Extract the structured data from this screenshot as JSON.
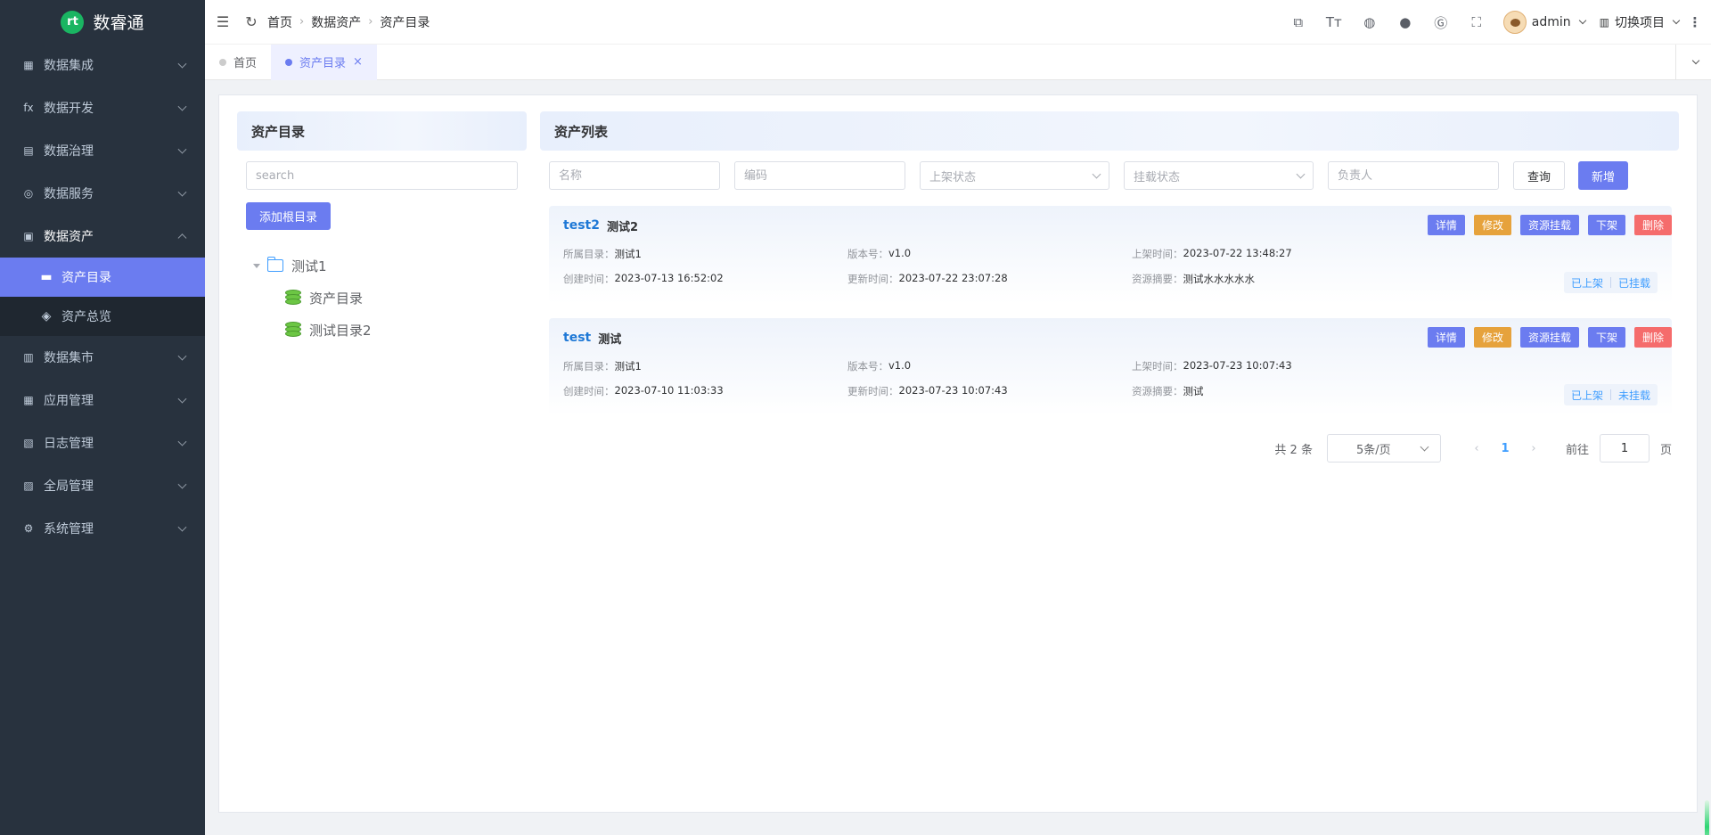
{
  "app": {
    "name": "数睿通"
  },
  "sidebar": {
    "items": [
      {
        "label": "数据集成",
        "icon": "chart-grid-icon",
        "glyph": "▦",
        "open": false
      },
      {
        "label": "数据开发",
        "icon": "function-icon",
        "glyph": "fx",
        "open": false
      },
      {
        "label": "数据治理",
        "icon": "table-icon",
        "glyph": "▤",
        "open": false
      },
      {
        "label": "数据服务",
        "icon": "service-icon",
        "glyph": "◎",
        "open": false
      },
      {
        "label": "数据资产",
        "icon": "terminal-icon",
        "glyph": "▣",
        "open": true
      },
      {
        "label": "数据集市",
        "icon": "market-icon",
        "glyph": "▥",
        "open": false
      },
      {
        "label": "应用管理",
        "icon": "app-icon",
        "glyph": "▦",
        "open": false
      },
      {
        "label": "日志管理",
        "icon": "log-icon",
        "glyph": "▧",
        "open": false
      },
      {
        "label": "全局管理",
        "icon": "global-icon",
        "glyph": "▨",
        "open": false
      },
      {
        "label": "系统管理",
        "icon": "settings-icon",
        "glyph": "⚙",
        "open": false
      }
    ],
    "subitems": [
      {
        "label": "资产目录",
        "icon": "catalog-icon",
        "glyph": "▬",
        "active": true
      },
      {
        "label": "资产总览",
        "icon": "overview-icon",
        "glyph": "◈",
        "active": false
      }
    ]
  },
  "navbar": {
    "breadcrumb": [
      "首页",
      "数据资产",
      "资产目录"
    ],
    "user": "admin",
    "project": "切换项目"
  },
  "tags": [
    {
      "label": "首页",
      "active": false
    },
    {
      "label": "资产目录",
      "active": true
    }
  ],
  "catalog": {
    "title": "资产目录",
    "search_placeholder": "search",
    "add_root": "添加根目录",
    "tree": {
      "root": "测试1",
      "children": [
        "资产目录",
        "测试目录2"
      ]
    }
  },
  "list": {
    "title": "资产列表",
    "filters": {
      "name_placeholder": "名称",
      "code_placeholder": "编码",
      "shelf_status": "上架状态",
      "mount_status": "挂载状态",
      "owner_placeholder": "负责人",
      "query": "查询",
      "add": "新增"
    },
    "actions": {
      "detail": "详情",
      "edit": "修改",
      "mount": "资源挂载",
      "offshelf": "下架",
      "delete": "删除"
    },
    "labels": {
      "catalog": "所属目录：",
      "version": "版本号：",
      "shelf_time": "上架时间：",
      "created": "创建时间：",
      "updated": "更新时间：",
      "summary": "资源摘要："
    },
    "assets": [
      {
        "code": "test2",
        "name": "测试2",
        "catalog": "测试1",
        "version": "v1.0",
        "shelf_time": "2023-07-22 13:48:27",
        "created": "2023-07-13 16:52:02",
        "updated": "2023-07-22 23:07:28",
        "summary": "测试水水水水水",
        "shelf_status": "已上架",
        "mount_status": "已挂载"
      },
      {
        "code": "test",
        "name": "测试",
        "catalog": "测试1",
        "version": "v1.0",
        "shelf_time": "2023-07-23 10:07:43",
        "created": "2023-07-10 11:03:33",
        "updated": "2023-07-23 10:07:43",
        "summary": "测试",
        "shelf_status": "已上架",
        "mount_status": "未挂载"
      }
    ]
  },
  "pagination": {
    "total": "共 2 条",
    "page_size": "5条/页",
    "current": "1",
    "goto": "前往",
    "goto_value": "1",
    "page_suffix": "页"
  },
  "colors": {
    "primary": "#6b7cf0",
    "warning": "#e6a23c",
    "danger": "#f56c6c",
    "sidebar": "#28323e",
    "link": "#1e78d6"
  }
}
